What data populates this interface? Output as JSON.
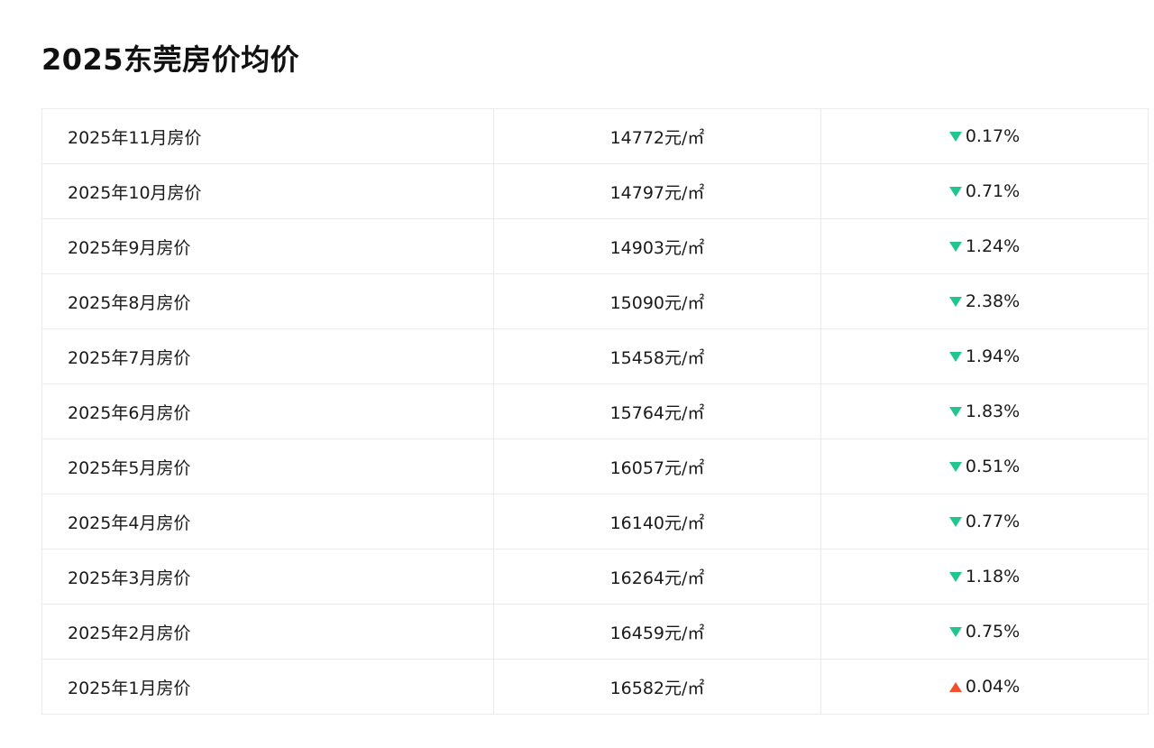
{
  "page": {
    "title": "2025东莞房价均价"
  },
  "colors": {
    "down": "#21c58e",
    "up": "#f0502d"
  },
  "rows": [
    {
      "month": "2025年11月房价",
      "price": "14772元/㎡",
      "change": "0.17%",
      "direction": "down"
    },
    {
      "month": "2025年10月房价",
      "price": "14797元/㎡",
      "change": "0.71%",
      "direction": "down"
    },
    {
      "month": "2025年9月房价",
      "price": "14903元/㎡",
      "change": "1.24%",
      "direction": "down"
    },
    {
      "month": "2025年8月房价",
      "price": "15090元/㎡",
      "change": "2.38%",
      "direction": "down"
    },
    {
      "month": "2025年7月房价",
      "price": "15458元/㎡",
      "change": "1.94%",
      "direction": "down"
    },
    {
      "month": "2025年6月房价",
      "price": "15764元/㎡",
      "change": "1.83%",
      "direction": "down"
    },
    {
      "month": "2025年5月房价",
      "price": "16057元/㎡",
      "change": "0.51%",
      "direction": "down"
    },
    {
      "month": "2025年4月房价",
      "price": "16140元/㎡",
      "change": "0.77%",
      "direction": "down"
    },
    {
      "month": "2025年3月房价",
      "price": "16264元/㎡",
      "change": "1.18%",
      "direction": "down"
    },
    {
      "month": "2025年2月房价",
      "price": "16459元/㎡",
      "change": "0.75%",
      "direction": "down"
    },
    {
      "month": "2025年1月房价",
      "price": "16582元/㎡",
      "change": "0.04%",
      "direction": "up"
    }
  ]
}
